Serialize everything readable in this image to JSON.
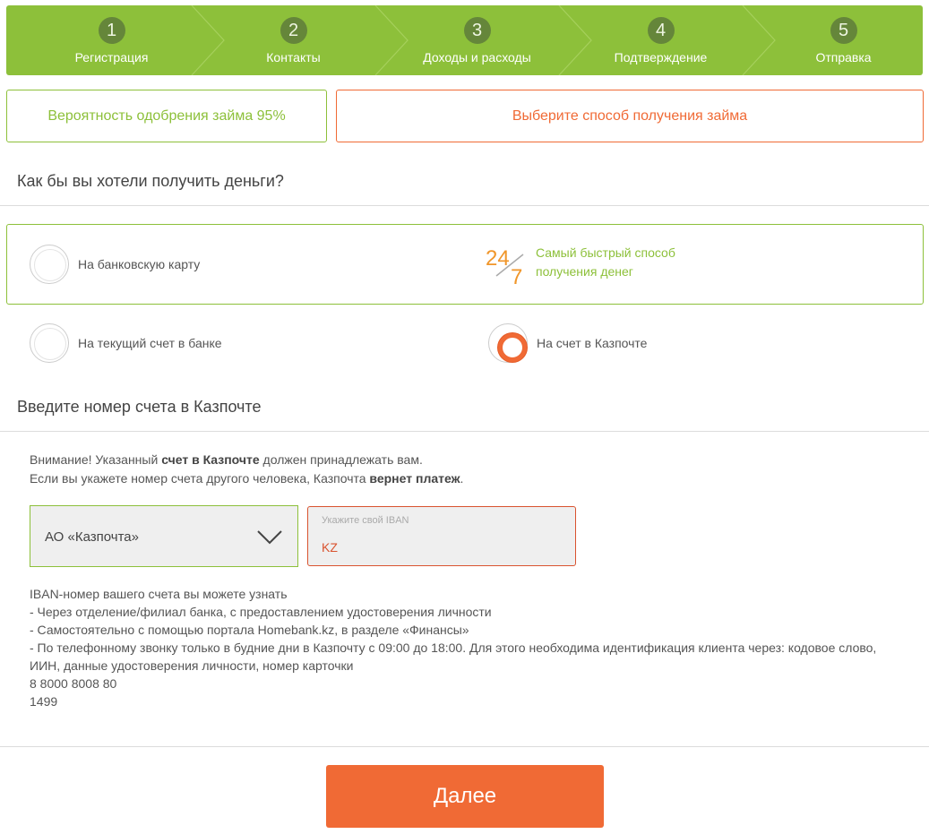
{
  "stepper": {
    "steps": [
      {
        "num": "1",
        "label": "Регистрация"
      },
      {
        "num": "2",
        "label": "Контакты"
      },
      {
        "num": "3",
        "label": "Доходы и расходы"
      },
      {
        "num": "4",
        "label": "Подтверждение"
      },
      {
        "num": "5",
        "label": "Отправка"
      }
    ],
    "color": "#8dc03a"
  },
  "info": {
    "approval": "Вероятность одобрения займа 95%",
    "method": "Выберите способ получения займа"
  },
  "question": "Как бы вы хотели получить деньги?",
  "options": {
    "card": "На банковскую карту",
    "bank_account": "На текущий счет в банке",
    "kazpost": "На счет в Казпочте",
    "selected": "kazpost"
  },
  "promo": {
    "icon": "24-7-icon",
    "line1": "Самый быстрый способ",
    "line2": "получения денег"
  },
  "account_heading": "Введите номер счета в Казпочте",
  "notice": {
    "l1_a": "Внимание! Указанный ",
    "l1_b": "счет в Казпочте",
    "l1_c": " должен принадлежать вам.",
    "l2_a": "Если вы укажете номер счета другого человека, Казпочта ",
    "l2_b": "вернет платеж",
    "l2_c": "."
  },
  "form": {
    "bank_select": "АО «Казпочта»",
    "iban_placeholder": "Укажите свой IBAN",
    "iban_value": "KZ"
  },
  "help": {
    "l1": "IBAN-номер вашего счета вы можете узнать",
    "l2": "- Через отделение/филиал банка, с предоставлением удостоверения личности",
    "l3": "- Самостоятельно с помощью портала Homebank.kz, в разделе «Финансы»",
    "l4": "- По телефонному звонку только в будние дни в Казпочту с 09:00 до 18:00. Для этого необходима идентификация клиента через: кодовое слово, ИИН, данные удостоверения личности, номер карточки",
    "l5": "8 8000 8008 80",
    "l6": "1499"
  },
  "next_button": "Далее",
  "colors": {
    "green": "#8dc03a",
    "orange": "#f06a35"
  }
}
